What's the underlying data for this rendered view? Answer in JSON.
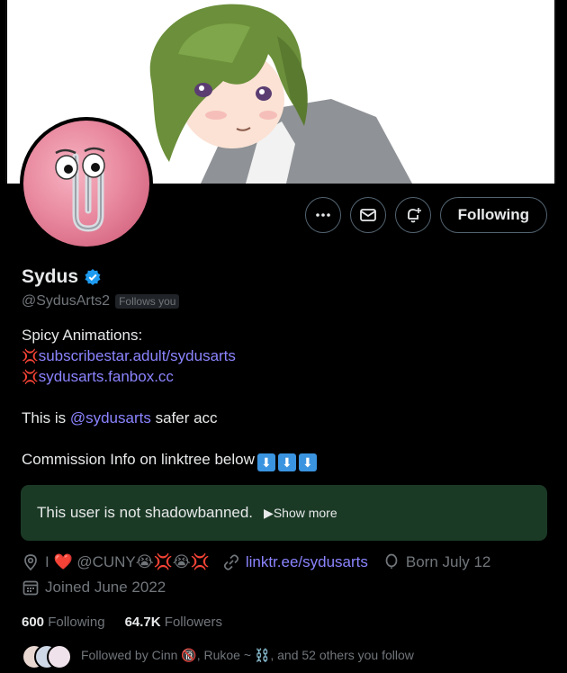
{
  "profile": {
    "display_name": "Sydus",
    "handle": "@SydusArts2",
    "follows_you": "Follows you",
    "verified": true
  },
  "actions": {
    "more_icon": "more-icon",
    "message_icon": "envelope-icon",
    "notify_icon": "bell-plus-icon",
    "follow_label": "Following"
  },
  "bio": {
    "line1": "Spicy Animations:",
    "link1": "subscribestar.adult/sydusarts",
    "link2": "sydusarts.fanbox.cc",
    "line4_pre": "This is ",
    "line4_mention": "@sydusarts",
    "line4_post": " safer acc",
    "line5": "Commission Info on linktree below"
  },
  "notice": {
    "text": "This user is not shadowbanned.",
    "show_more": "▶Show more"
  },
  "meta": {
    "location": "I ❤️ @CUNY😭💢😭💢",
    "website": "linktr.ee/sydusarts",
    "birthday": "Born July 12",
    "joined": "Joined June 2022"
  },
  "counts": {
    "following_num": "600",
    "following_label": "Following",
    "followers_num": "64.7K",
    "followers_label": "Followers"
  },
  "followed_by": "Followed by Cinn 🔞, Rukoe ~ ⛓️, and 52 others you follow",
  "colors": {
    "background": "#000000",
    "link": "#8b84ff",
    "verified": "#1d9bf0",
    "notice_bg": "#1b3a26",
    "muted": "#71767b"
  }
}
